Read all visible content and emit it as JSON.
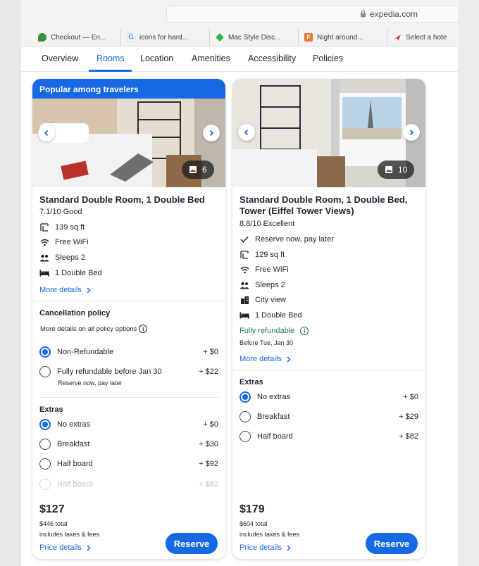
{
  "browser": {
    "url": "expedia.com",
    "tabs": [
      {
        "label": "Checkout — En...",
        "fav_color": "#3a8f3a"
      },
      {
        "label": "icons for hard...",
        "fav_color": "#4285f4"
      },
      {
        "label": "Mac Style Disc...",
        "fav_color": "#32b34a"
      },
      {
        "label": "Night around...",
        "fav_color": "#e8772e"
      },
      {
        "label": "Select a hote",
        "fav_color": "#d0312d"
      }
    ]
  },
  "nav": {
    "overview": "Overview",
    "rooms": "Rooms",
    "location": "Location",
    "amenities": "Amenities",
    "accessibility": "Accessibility",
    "policies": "Policies"
  },
  "room1": {
    "badge": "Popular among travelers",
    "photo_count": "6",
    "title": "Standard Double Room, 1 Double Bed",
    "rating": "7.1/10 Good",
    "amenities": [
      {
        "icon": "area-icon",
        "label": "139 sq ft"
      },
      {
        "icon": "wifi-icon",
        "label": "Free WiFi"
      },
      {
        "icon": "people-icon",
        "label": "Sleeps 2"
      },
      {
        "icon": "bed-icon",
        "label": "1 Double Bed"
      }
    ],
    "more_details": "More details",
    "cancellation": {
      "title": "Cancellation policy",
      "more_info": "More details on all policy options",
      "options": [
        {
          "label": "Non-Refundable",
          "price": "+ $0",
          "selected": true
        },
        {
          "label": "Fully refundable before Jan 30",
          "price": "+ $22",
          "selected": false,
          "sub": "Reserve now, pay later"
        }
      ]
    },
    "extras": {
      "title": "Extras",
      "options": [
        {
          "label": "No extras",
          "price": "+ $0",
          "selected": true
        },
        {
          "label": "Breakfast",
          "price": "+ $30",
          "selected": false
        },
        {
          "label": "Half board",
          "price": "+ $92",
          "selected": false
        },
        {
          "label": "Half board",
          "price": "+ $82",
          "selected": false
        }
      ]
    },
    "price": "$127",
    "total": "$446 total",
    "taxes": "includes taxes & fees",
    "price_details": "Price details",
    "reserve": "Reserve"
  },
  "room2": {
    "photo_count": "10",
    "title_line1": "Standard Double Room, 1 Double Bed,",
    "title_line2": "Tower (Eiffel Tower Views)",
    "rating": "8.8/10 Excellent",
    "amenities": [
      {
        "icon": "check-icon",
        "label": "Reserve now, pay later"
      },
      {
        "icon": "area-icon",
        "label": "129 sq ft"
      },
      {
        "icon": "wifi-icon",
        "label": "Free WiFi"
      },
      {
        "icon": "people-icon",
        "label": "Sleeps 2"
      },
      {
        "icon": "city-icon",
        "label": "City view"
      },
      {
        "icon": "bed-icon",
        "label": "1 Double Bed"
      }
    ],
    "refundable": "Fully refundable",
    "refundable_before": "Before Tue, Jan 30",
    "more_details": "More details",
    "extras": {
      "title": "Extras",
      "options": [
        {
          "label": "No extras",
          "price": "+ $0",
          "selected": true
        },
        {
          "label": "Breakfast",
          "price": "+ $29",
          "selected": false
        },
        {
          "label": "Half board",
          "price": "+ $82",
          "selected": false
        }
      ]
    },
    "price": "$179",
    "total": "$604 total",
    "taxes": "includes taxes & fees",
    "price_details": "Price details",
    "reserve": "Reserve"
  },
  "colors": {
    "accent": "#1668e3",
    "refundable_green": "#227950"
  }
}
